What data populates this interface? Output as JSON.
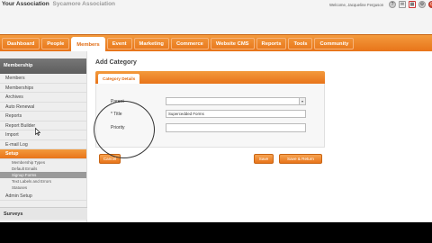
{
  "brand": {
    "name": "Your Association",
    "product": "Sycamore Association"
  },
  "header": {
    "welcome": "Welcome, Jacqueline Ferguson",
    "icons": [
      "help-icon",
      "mail-icon",
      "calendar-icon",
      "settings-icon",
      "logout-icon"
    ]
  },
  "nav": {
    "items": [
      {
        "label": "Dashboard"
      },
      {
        "label": "People"
      },
      {
        "label": "Members"
      },
      {
        "label": "Event"
      },
      {
        "label": "Marketing"
      },
      {
        "label": "Commerce"
      },
      {
        "label": "Website CMS"
      },
      {
        "label": "Reports"
      },
      {
        "label": "Tools"
      },
      {
        "label": "Community"
      }
    ],
    "active": "Members"
  },
  "sidebar": {
    "heading": "Membership",
    "items": [
      {
        "label": "Members"
      },
      {
        "label": "Memberships"
      },
      {
        "label": "Archives"
      },
      {
        "label": "Auto Renewal"
      },
      {
        "label": "Reports"
      },
      {
        "label": "Report Builder"
      },
      {
        "label": "Import"
      },
      {
        "label": "E-mail Log"
      },
      {
        "label": "Setup"
      }
    ],
    "sub_items": [
      {
        "label": "Membership Types"
      },
      {
        "label": "Default Emails"
      },
      {
        "label": "Signup Forms"
      },
      {
        "label": "Text Labels and Errors"
      },
      {
        "label": "Statuses"
      }
    ],
    "extra": "Admin Setup",
    "footer": "Surveys"
  },
  "main": {
    "title": "Add Category",
    "tab": "Category Details",
    "form": {
      "parent_label": "Parent",
      "parent_value": "",
      "title_label": "* Title",
      "title_value": "Supercedded Forms",
      "priority_label": "Priority",
      "priority_value": ""
    },
    "buttons": {
      "cancel": "Cancel",
      "save": "Save",
      "save_return": "Save & Return"
    }
  },
  "colors": {
    "accent": "#e8741a",
    "sidebar_bg": "#eeeeee",
    "header_bg": "#f4f4f4"
  }
}
